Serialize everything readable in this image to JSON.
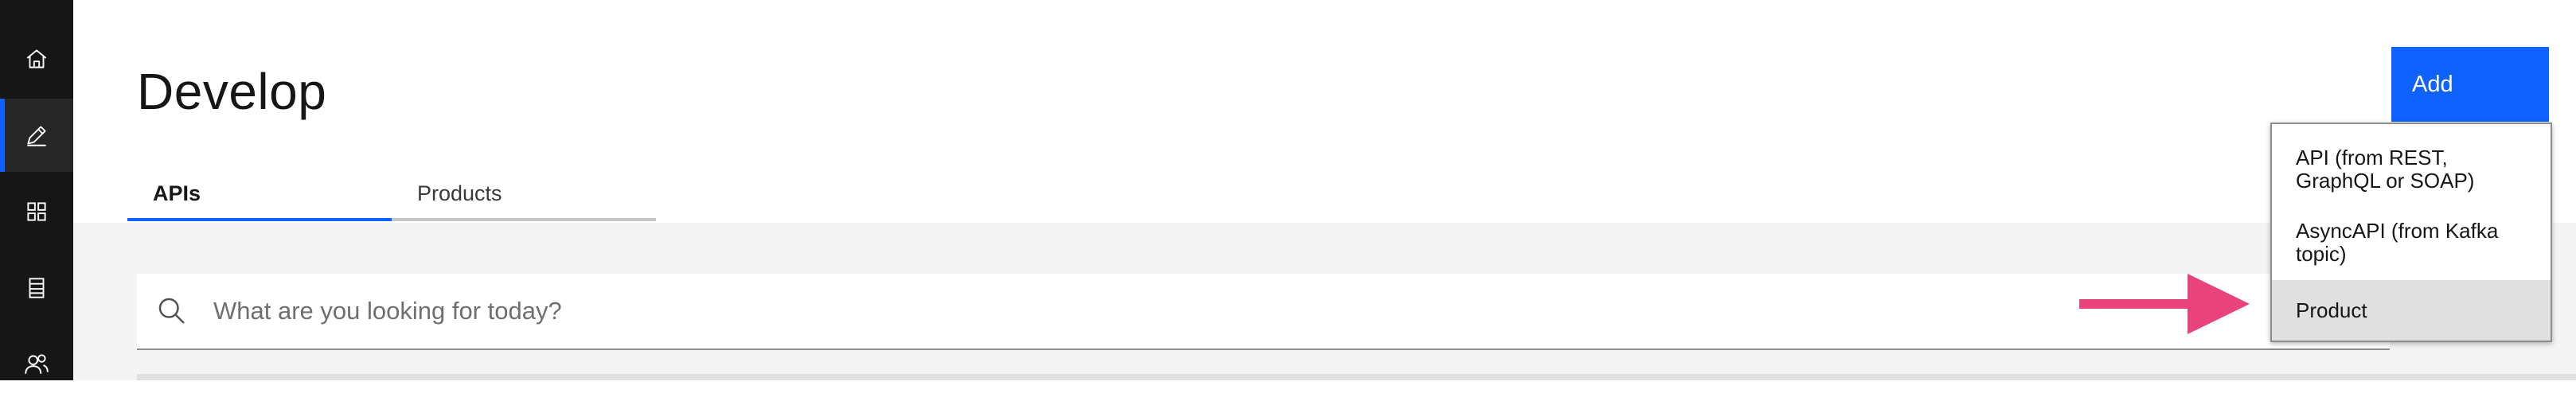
{
  "sidebar": {
    "items": [
      {
        "icon": "home-icon",
        "active": false
      },
      {
        "icon": "edit-icon",
        "active": true
      },
      {
        "icon": "apps-grid-icon",
        "active": false
      },
      {
        "icon": "catalog-icon",
        "active": false
      },
      {
        "icon": "user-group-icon",
        "active": false
      }
    ]
  },
  "page": {
    "title": "Develop",
    "tabs": [
      {
        "label": "APIs",
        "active": true
      },
      {
        "label": "Products",
        "active": false
      }
    ]
  },
  "search": {
    "placeholder": "What are you looking for today?",
    "value": ""
  },
  "add_button": {
    "label": "Add"
  },
  "add_menu": {
    "items": [
      {
        "line1": "API (from REST,",
        "line2": "GraphQL or SOAP)"
      },
      {
        "line1": "AsyncAPI (from Kafka",
        "line2": "topic)"
      },
      {
        "line1": "Product",
        "line2": ""
      }
    ],
    "highlighted_index": 2
  },
  "colors": {
    "accent": "#0f62fe",
    "rail": "#161616",
    "arrow": "#e8437a",
    "background": "#f4f4f4"
  }
}
